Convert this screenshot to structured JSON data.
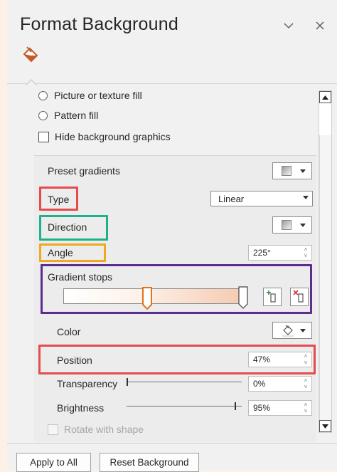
{
  "header": {
    "title": "Format Background",
    "dropdown_icon": "chevron-down-icon",
    "close_icon": "close-icon",
    "tab_icon": "paint-bucket-icon"
  },
  "fill_options": {
    "picture_fill": "Picture or texture fill",
    "pattern_fill": "Pattern fill",
    "hide_background_graphics": "Hide background graphics"
  },
  "gradient": {
    "preset_label": "Preset gradients",
    "type_label": "Type",
    "type_value": "Linear",
    "direction_label": "Direction",
    "angle_label": "Angle",
    "angle_value": "225°",
    "stops_label": "Gradient stops",
    "stop_positions": [
      0.47,
      0.95
    ],
    "color_label": "Color",
    "position_label": "Position",
    "position_value": "47%",
    "transparency_label": "Transparency",
    "transparency_value": "0%",
    "transparency_level": 0,
    "brightness_label": "Brightness",
    "brightness_value": "95%",
    "brightness_level": 0.95,
    "rotate_label": "Rotate with shape"
  },
  "footer": {
    "apply_all": "Apply to All",
    "reset": "Reset Background"
  },
  "colors": {
    "highlight_red": "#e64b4b",
    "highlight_teal": "#20b08a",
    "highlight_orange": "#f0a820",
    "highlight_purple": "#5b2d8e",
    "accent": "#c55a28"
  }
}
